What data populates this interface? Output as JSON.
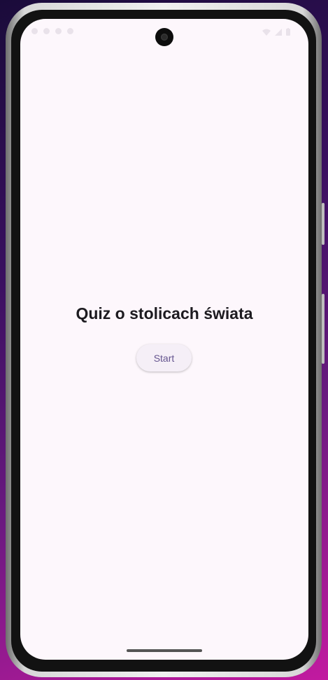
{
  "app": {
    "title": "Quiz o stolicach świata",
    "start_button_label": "Start"
  },
  "status_bar": {
    "left_icons": [
      "clock-icon",
      "notification-icon",
      "notification-icon",
      "notification-icon"
    ],
    "right_icons": [
      "wifi-icon",
      "signal-icon",
      "battery-icon"
    ]
  },
  "colors": {
    "screen_background": "#fdf7fc",
    "title_text": "#1d1b20",
    "button_background": "#f5eff7",
    "button_text": "#65558f"
  }
}
